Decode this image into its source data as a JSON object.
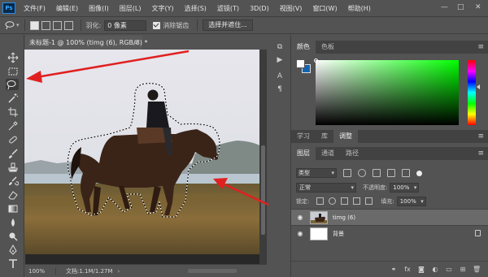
{
  "app": {
    "logo": "Ps"
  },
  "menu": [
    "文件(F)",
    "编辑(E)",
    "图像(I)",
    "图层(L)",
    "文字(Y)",
    "选择(S)",
    "滤镜(T)",
    "3D(D)",
    "视图(V)",
    "窗口(W)",
    "帮助(H)"
  ],
  "window_controls": {
    "minimize": "—",
    "maximize": "□",
    "close": "✕"
  },
  "options": {
    "feather_label": "羽化:",
    "feather_value": "0 像素",
    "antialias_label": "消除锯齿",
    "select_mask_button": "选择并遮住..."
  },
  "document": {
    "tab_title": "未标题-1 @ 100% (timg (6), RGB/8) *",
    "tab_close": "×",
    "zoom": "100%",
    "doc_info": "文档:1.1M/1.27M"
  },
  "side_strip": {
    "char_label": "A",
    "para_label": "¶"
  },
  "color_panel": {
    "tabs": [
      "颜色",
      "色板"
    ],
    "foreground": "#ffffff",
    "background": "#1464b4"
  },
  "mid_tabs": [
    "学习",
    "库",
    "调整"
  ],
  "layers_panel": {
    "tabs": [
      "图层",
      "通道",
      "路径"
    ],
    "kind_filter": "类型",
    "blend_mode": "正常",
    "opacity_label": "不透明度:",
    "opacity_value": "100%",
    "lock_label": "锁定:",
    "fill_label": "填充:",
    "fill_value": "100%",
    "layers": [
      {
        "name": "timg (6)",
        "selected": true
      },
      {
        "name": "背景",
        "selected": false,
        "locked": true
      }
    ],
    "footer_fx": "fx"
  },
  "colors": {
    "annotation_arrow": "#e02020",
    "accent": "#31a8ff"
  }
}
